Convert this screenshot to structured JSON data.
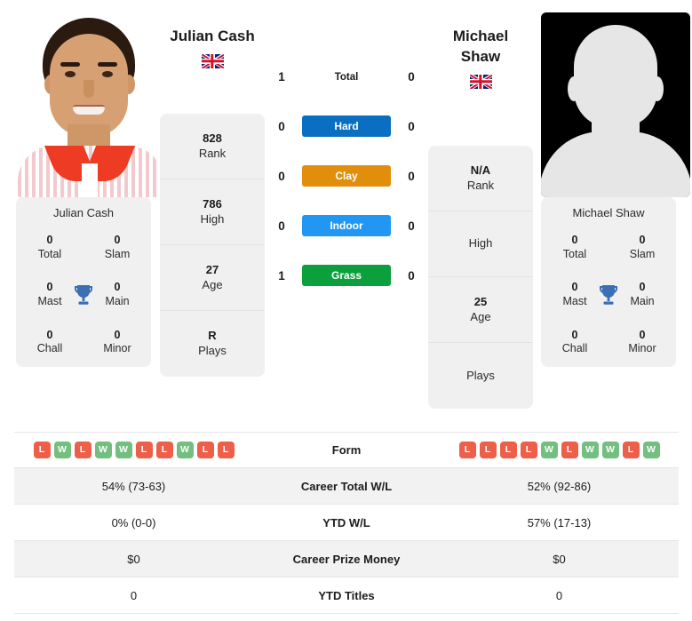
{
  "players": {
    "left": {
      "name": "Julian Cash",
      "flag": "gb-flag-icon",
      "photo": "player-photo",
      "rank": "828",
      "rank_label": "Rank",
      "high": "786",
      "high_label": "High",
      "age": "27",
      "age_label": "Age",
      "plays": "R",
      "plays_label": "Plays",
      "titles": {
        "card_name": "Julian Cash",
        "total": "0",
        "total_label": "Total",
        "slam": "0",
        "slam_label": "Slam",
        "mast": "0",
        "mast_label": "Mast",
        "main": "0",
        "main_label": "Main",
        "chall": "0",
        "chall_label": "Chall",
        "minor": "0",
        "minor_label": "Minor"
      }
    },
    "right": {
      "name_line1": "Michael",
      "name_line2": "Shaw",
      "flag": "gb-flag-icon",
      "photo": "player-photo-placeholder",
      "rank": "N/A",
      "rank_label": "Rank",
      "high": "",
      "high_label": "High",
      "age": "25",
      "age_label": "Age",
      "plays": "",
      "plays_label": "Plays",
      "titles": {
        "card_name": "Michael Shaw",
        "total": "0",
        "total_label": "Total",
        "slam": "0",
        "slam_label": "Slam",
        "mast": "0",
        "mast_label": "Mast",
        "main": "0",
        "main_label": "Main",
        "chall": "0",
        "chall_label": "Chall",
        "minor": "0",
        "minor_label": "Minor"
      }
    }
  },
  "head_to_head": {
    "rows": [
      {
        "label": "Total",
        "left": "1",
        "right": "0",
        "color": "",
        "pill": false
      },
      {
        "label": "Hard",
        "left": "0",
        "right": "0",
        "color": "#0a6ec1",
        "pill": true
      },
      {
        "label": "Clay",
        "left": "0",
        "right": "0",
        "color": "#e08e0b",
        "pill": true
      },
      {
        "label": "Indoor",
        "left": "0",
        "right": "0",
        "color": "#2196f3",
        "pill": true
      },
      {
        "label": "Grass",
        "left": "1",
        "right": "0",
        "color": "#0ca03c",
        "pill": true
      }
    ]
  },
  "stats_table": {
    "rows": [
      {
        "label": "Form",
        "type": "form",
        "left_form": [
          "L",
          "W",
          "L",
          "W",
          "W",
          "L",
          "L",
          "W",
          "L",
          "L"
        ],
        "right_form": [
          "L",
          "L",
          "L",
          "L",
          "W",
          "L",
          "W",
          "W",
          "L",
          "W"
        ]
      },
      {
        "label": "Career Total W/L",
        "type": "text",
        "left": "54% (73-63)",
        "right": "52% (92-86)"
      },
      {
        "label": "YTD W/L",
        "type": "text",
        "left": "0% (0-0)",
        "right": "57% (17-13)"
      },
      {
        "label": "Career Prize Money",
        "type": "text",
        "left": "$0",
        "right": "$0"
      },
      {
        "label": "YTD Titles",
        "type": "text",
        "left": "0",
        "right": "0"
      }
    ]
  },
  "colors": {
    "hard": "#0a6ec1",
    "clay": "#e08e0b",
    "indoor": "#2196f3",
    "grass": "#0ca03c",
    "win_badge": "#72bf7f",
    "loss_badge": "#ee5f4a",
    "trophy": "#3c6eb4",
    "card_bg": "#f0f0f0"
  }
}
